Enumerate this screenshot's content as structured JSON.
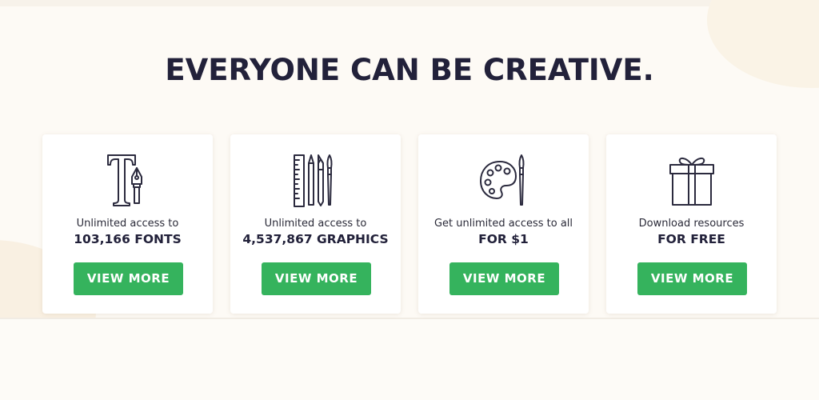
{
  "headline": "EVERYONE CAN BE CREATIVE.",
  "colors": {
    "background": "#fdfaf5",
    "headline": "#22213a",
    "button": "#35b35d",
    "button_text": "#ffffff",
    "icon_stroke": "#2b2a3e"
  },
  "cards": [
    {
      "icon": "font-pen-icon",
      "subtitle": "Unlimited access to",
      "highlight": "103,166 FONTS",
      "button_label": "VIEW MORE"
    },
    {
      "icon": "ruler-pencils-icon",
      "subtitle": "Unlimited access to",
      "highlight": "4,537,867 GRAPHICS",
      "button_label": "VIEW MORE"
    },
    {
      "icon": "palette-brush-icon",
      "subtitle": "Get unlimited access to all",
      "highlight": "FOR $1",
      "button_label": "VIEW MORE"
    },
    {
      "icon": "gift-box-icon",
      "subtitle": "Download resources",
      "highlight": "FOR FREE",
      "button_label": "VIEW MORE"
    }
  ]
}
